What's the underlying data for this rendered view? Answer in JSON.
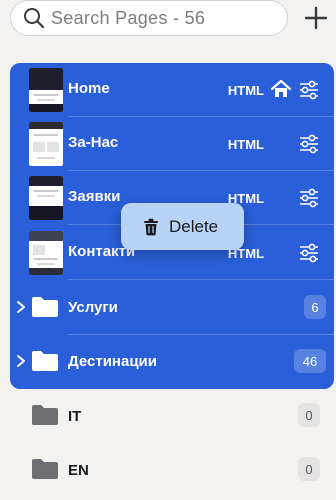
{
  "search": {
    "placeholder": "Search Pages - 56"
  },
  "pages": [
    {
      "title": "Home",
      "type": "HTML",
      "is_home": true
    },
    {
      "title": "За-Нас",
      "type": "HTML",
      "is_home": false
    },
    {
      "title": "Заявки",
      "type": "HTML",
      "is_home": false
    },
    {
      "title": "Контакти",
      "type": "HTML",
      "is_home": false
    }
  ],
  "selected_folders": [
    {
      "title": "Услуги",
      "count": "6"
    },
    {
      "title": "Дестинации",
      "count": "46"
    }
  ],
  "folders": [
    {
      "title": "IT",
      "count": "0"
    },
    {
      "title": "EN",
      "count": "0"
    }
  ],
  "context_menu": {
    "delete_label": "Delete"
  },
  "colors": {
    "selection": "#2a5fd9",
    "menu": "#b9d3f7",
    "background": "#f3f2f0"
  }
}
